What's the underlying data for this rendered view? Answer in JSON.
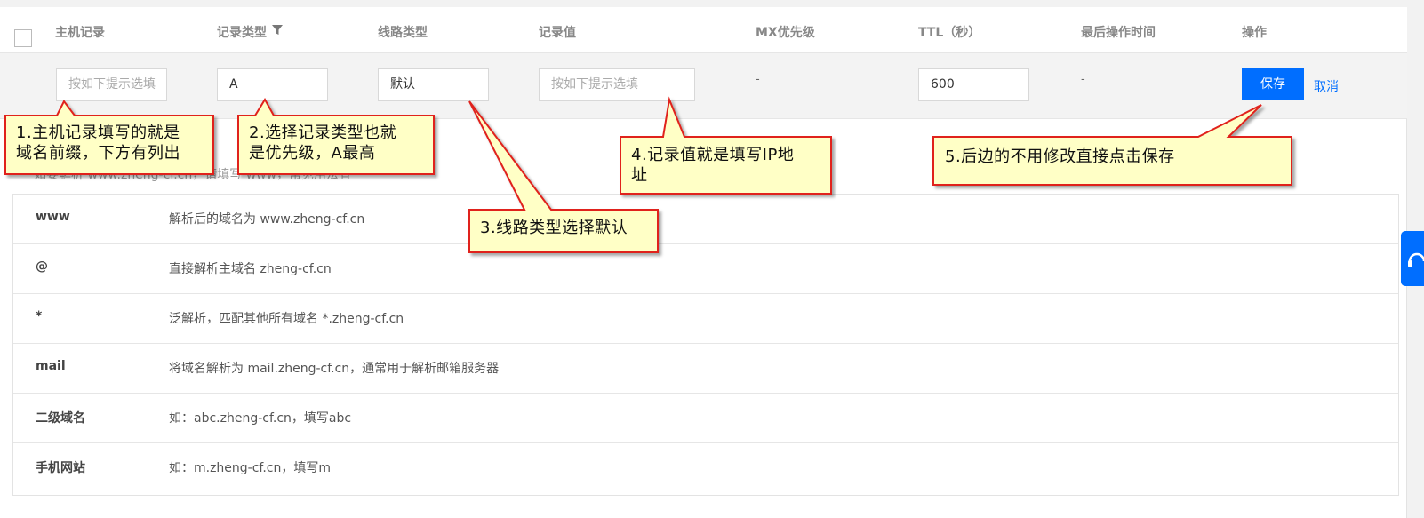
{
  "table_header": {
    "host_record": "主机记录",
    "record_type": "记录类型",
    "line_type": "线路类型",
    "record_value": "记录值",
    "mx_priority": "MX优先级",
    "ttl": "TTL（秒）",
    "last_op_time": "最后操作时间",
    "actions": "操作"
  },
  "edit_row": {
    "host_record_placeholder": "按如下提示选填",
    "record_type_value": "A",
    "line_type_value": "默认",
    "record_value_placeholder": "按如下提示选填",
    "mx_value": "-",
    "ttl_value": "600",
    "last_op_time_value": "-",
    "save_label": "保存",
    "cancel_label": "取消"
  },
  "hint_line": "如要解析 www.zheng-cf.cn，请填写 www，常见用法有",
  "examples": [
    {
      "key": "www",
      "desc": "解析后的域名为 www.zheng-cf.cn"
    },
    {
      "key": "@",
      "desc": "直接解析主域名 zheng-cf.cn"
    },
    {
      "key": "*",
      "desc": "泛解析，匹配其他所有域名 *.zheng-cf.cn"
    },
    {
      "key": "mail",
      "desc": "将域名解析为 mail.zheng-cf.cn，通常用于解析邮箱服务器"
    },
    {
      "key": "二级域名",
      "desc": "如：abc.zheng-cf.cn，填写abc"
    },
    {
      "key": "手机网站",
      "desc": "如：m.zheng-cf.cn，填写m"
    }
  ],
  "callouts": {
    "c1_line1": "1.主机记录填写的就是",
    "c1_line2": "域名前缀，下方有列出",
    "c2_line1": "2.选择记录类型也就",
    "c2_line2": "是优先级，A最高",
    "c3": "3.线路类型选择默认",
    "c4_line1": "4.记录值就是填写IP地",
    "c4_line2": "址",
    "c5": "5.后边的不用修改直接点击保存"
  },
  "colors": {
    "primary": "#006eff",
    "callout_fill": "#ffffc6",
    "callout_border": "#e0201b"
  },
  "icons": {
    "filter": "filter-icon",
    "float_tab": "headset-icon"
  }
}
